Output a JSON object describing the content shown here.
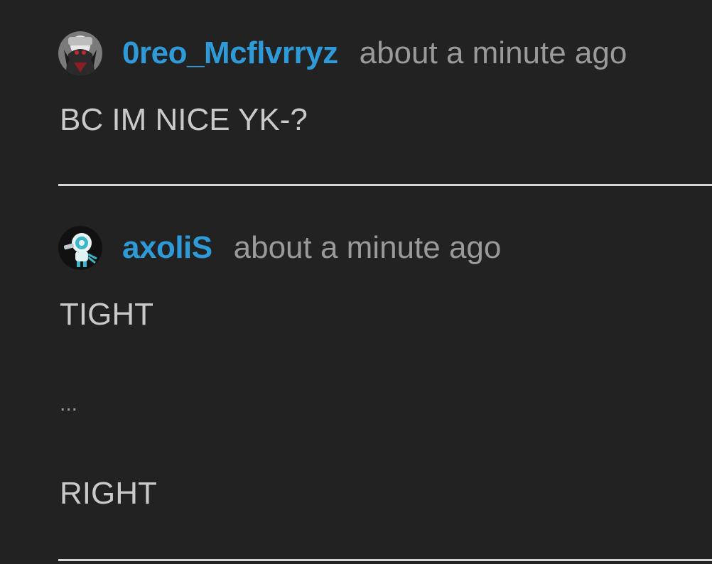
{
  "comments": [
    {
      "username": "0reo_Mcflvrryz",
      "timestamp": "about a minute ago",
      "avatar_icon": "user-avatar-icon",
      "lines": [
        "BC IM NICE YK-?"
      ]
    },
    {
      "username": "axoliS",
      "timestamp": "about a minute ago",
      "avatar_icon": "user-avatar-icon",
      "lines": [
        "TIGHT",
        "...",
        "RIGHT"
      ]
    }
  ],
  "colors": {
    "background": "#222222",
    "username": "#2e9bd8",
    "timestamp": "#9a9a9a",
    "body_text": "#c9c9c9",
    "divider": "#d6d6d6"
  }
}
